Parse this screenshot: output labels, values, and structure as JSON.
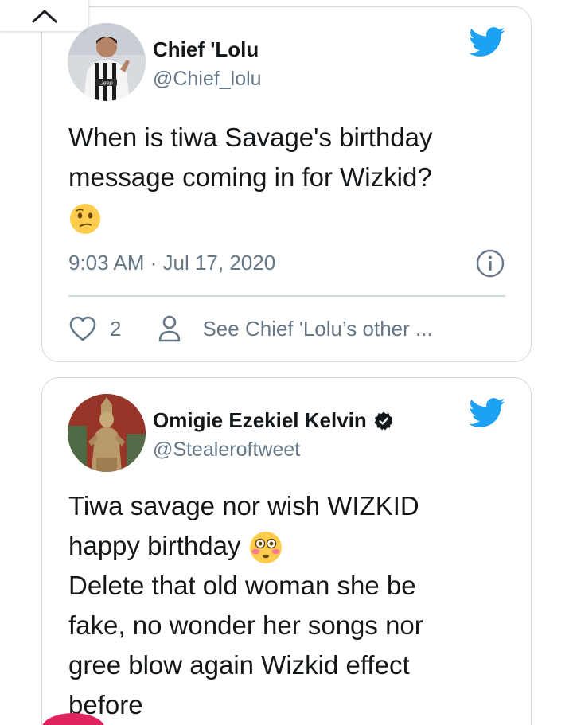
{
  "tweets": [
    {
      "name": "Chief 'Lolu",
      "handle": "@Chief_lolu",
      "verified": false,
      "text_lines": [
        "When is tiwa Savage's birthday",
        "message coming in for Wizkid?"
      ],
      "emoji": "confused-face",
      "timestamp": "9:03 AM · Jul 17, 2020",
      "likes": "2",
      "other_link": "See Chief 'Lolu’s other ..."
    },
    {
      "name": "Omigie Ezekiel Kelvin",
      "handle": "@Stealeroftweet",
      "verified": true,
      "text_line1": "Tiwa savage nor wish WIZKID",
      "text_line2": "happy birthday",
      "emoji": "flushed-face",
      "text_rest": [
        "Delete that old woman she be",
        "fake, no wonder her songs nor",
        "gree blow again Wizkid effect",
        "before"
      ]
    }
  ],
  "colors": {
    "twitter_blue": "#1da1f2",
    "text": "#14171a",
    "muted": "#657786",
    "border": "#cfd9de"
  }
}
